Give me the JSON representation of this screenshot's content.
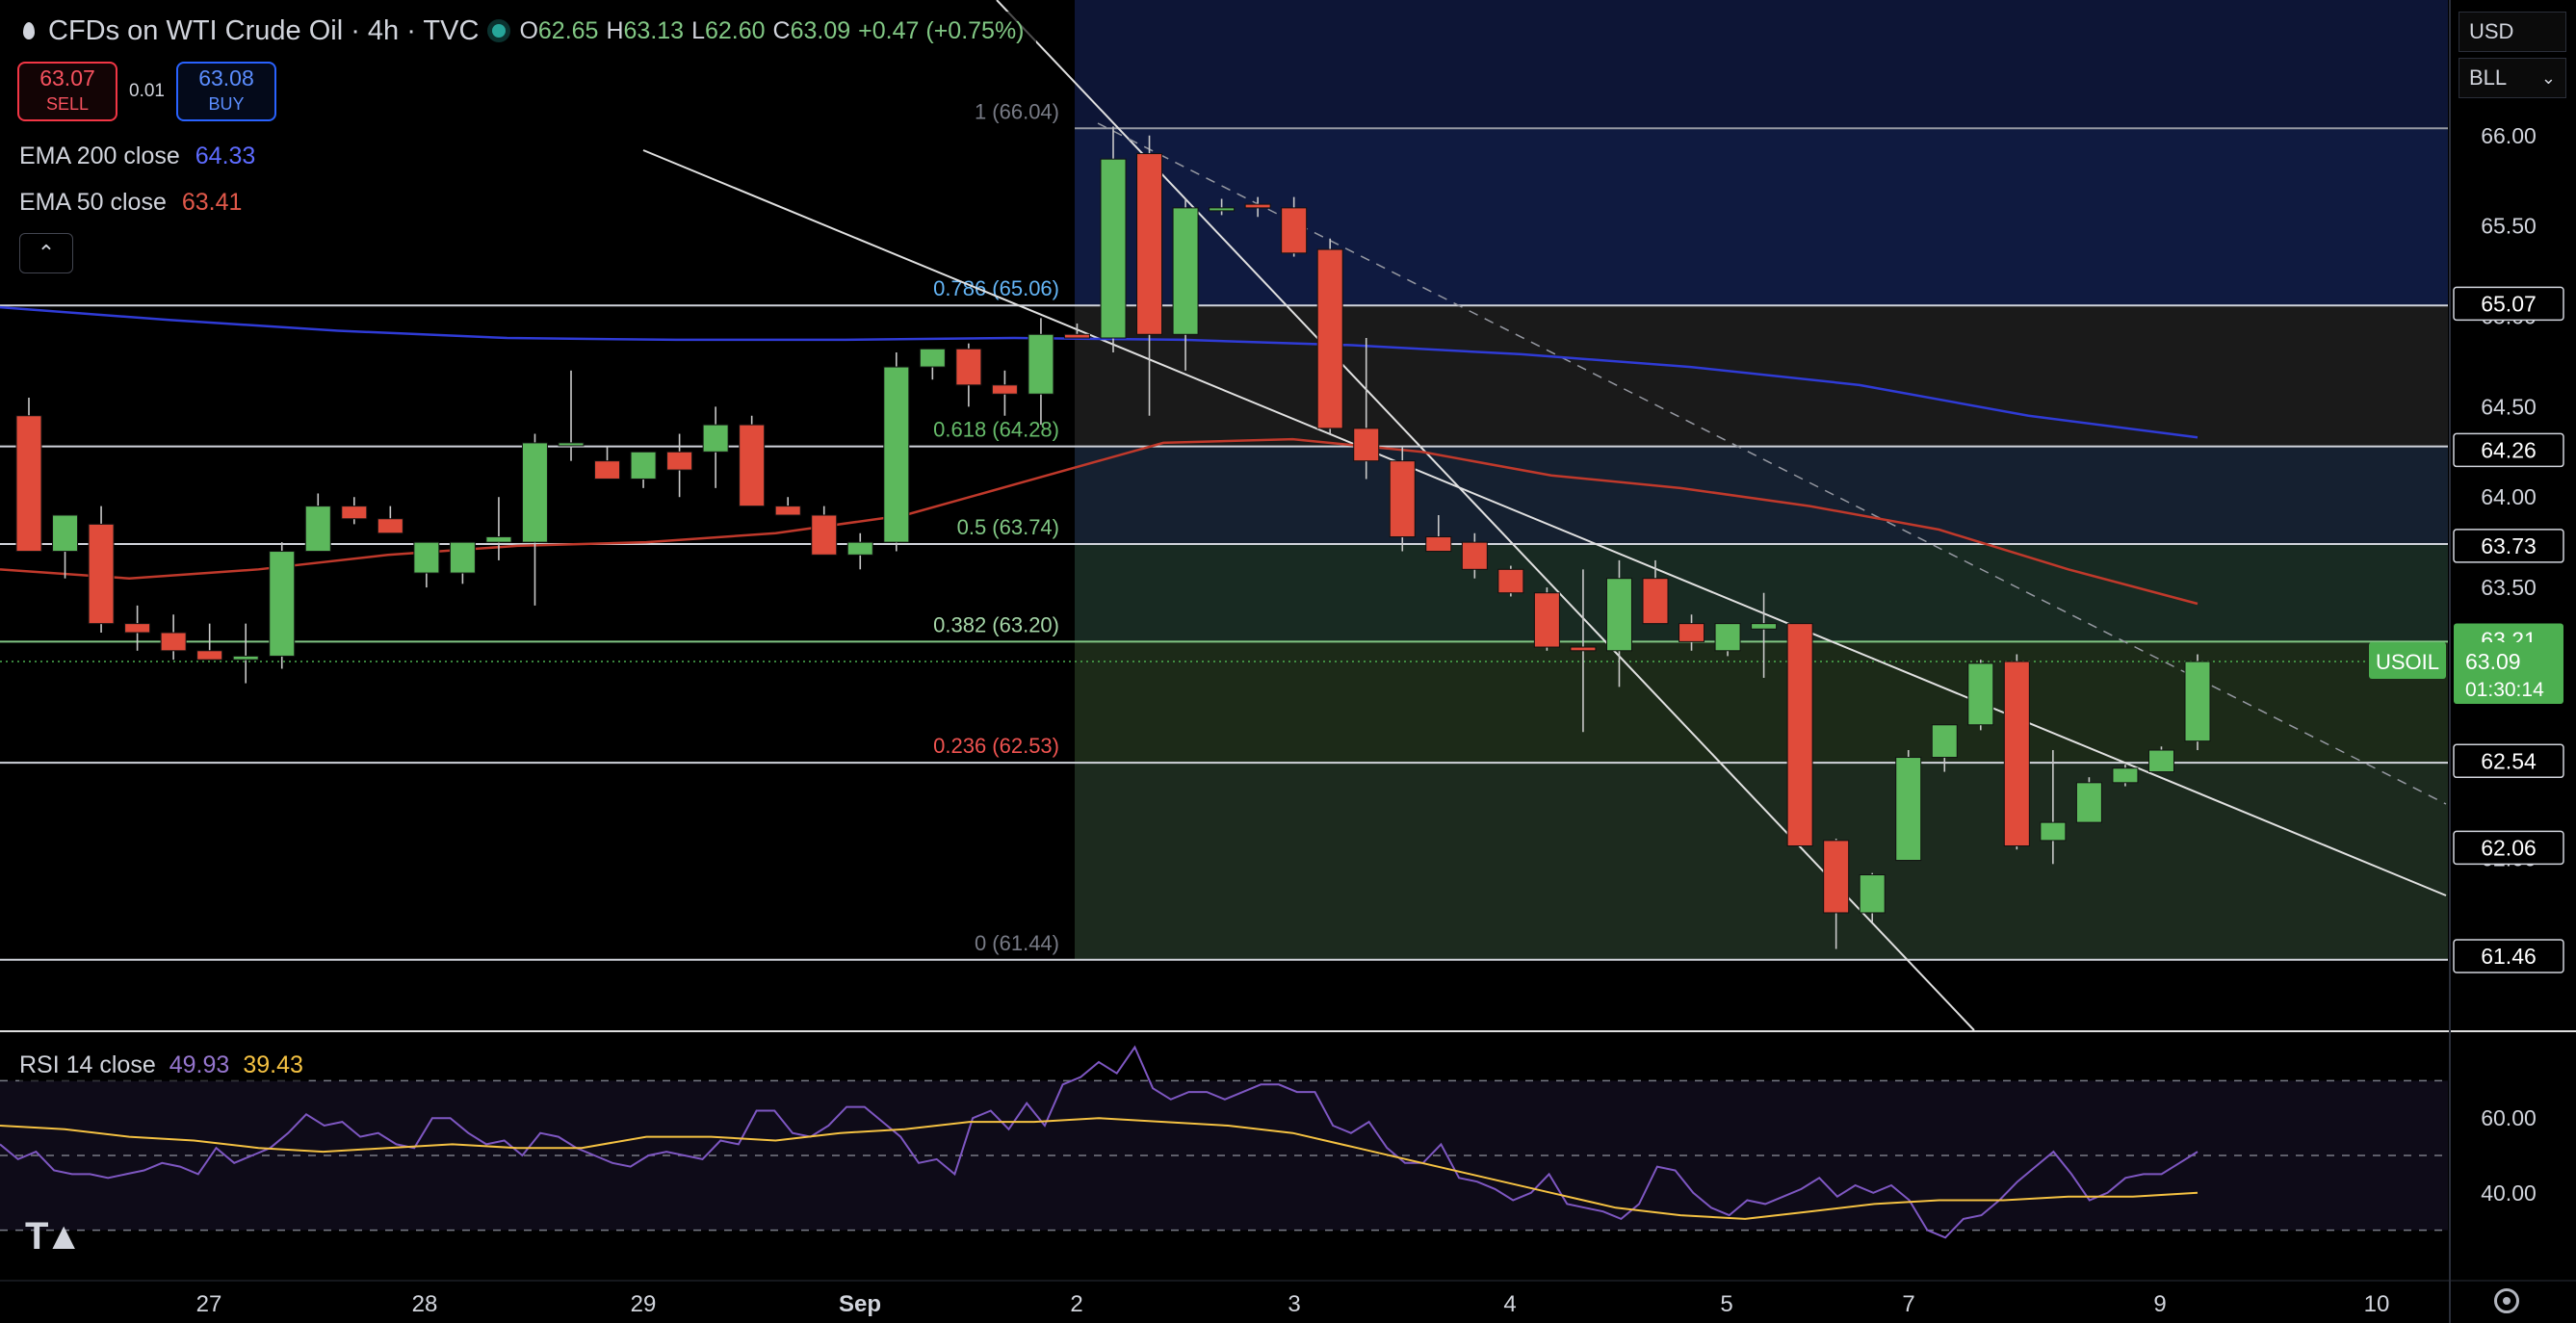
{
  "header": {
    "title": "CFDs on WTI Crude Oil · 4h · TVC",
    "open_label": "O",
    "open": "62.65",
    "high_label": "H",
    "high": "63.13",
    "low_label": "L",
    "low": "62.60",
    "close_label": "C",
    "close": "63.09",
    "change": "+0.47 (+0.75%)"
  },
  "trade": {
    "sell_price": "63.07",
    "sell_label": "SELL",
    "spread": "0.01",
    "buy_price": "63.08",
    "buy_label": "BUY"
  },
  "indicators": {
    "ema200_label": "EMA 200 close",
    "ema200_value": "64.33",
    "ema50_label": "EMA 50 close",
    "ema50_value": "63.41",
    "rsi_label": "RSI 14 close",
    "rsi_value": "49.93",
    "rsi_ma_value": "39.43"
  },
  "selectors": {
    "currency": "USD",
    "unit": "BLL"
  },
  "colors": {
    "up": "#5cb85c",
    "down": "#e04b3a",
    "ema200": "#2f3bd6",
    "ema50": "#c0392b",
    "rsi": "#7e57c2",
    "rsi_ma": "#f5c242"
  },
  "chart_data": {
    "type": "candlestick",
    "symbol": "USOIL",
    "timeframe": "4h",
    "x_ticks": [
      "27",
      "28",
      "29",
      "Sep",
      "2",
      "3",
      "4",
      "5",
      "7",
      "9",
      "10"
    ],
    "y_ticks": [
      "66.00",
      "65.50",
      "65.00",
      "64.50",
      "64.00",
      "63.50",
      "63.00",
      "62.50",
      "62.00",
      "61.50"
    ],
    "ylim": [
      61.05,
      66.75
    ],
    "candles": [
      [
        64.45,
        64.55,
        63.7,
        63.7
      ],
      [
        63.7,
        63.9,
        63.55,
        63.9
      ],
      [
        63.85,
        63.95,
        63.25,
        63.3
      ],
      [
        63.3,
        63.4,
        63.15,
        63.25
      ],
      [
        63.25,
        63.35,
        63.1,
        63.15
      ],
      [
        63.15,
        63.3,
        63.1,
        63.1
      ],
      [
        63.1,
        63.3,
        62.97,
        63.12
      ],
      [
        63.12,
        63.75,
        63.05,
        63.7
      ],
      [
        63.7,
        64.02,
        63.7,
        63.95
      ],
      [
        63.95,
        64.0,
        63.85,
        63.88
      ],
      [
        63.88,
        63.95,
        63.8,
        63.8
      ],
      [
        63.58,
        63.75,
        63.5,
        63.75
      ],
      [
        63.58,
        63.75,
        63.52,
        63.75
      ],
      [
        63.75,
        64.0,
        63.65,
        63.78
      ],
      [
        63.75,
        64.35,
        63.4,
        64.3
      ],
      [
        64.3,
        64.7,
        64.2,
        64.3
      ],
      [
        64.2,
        64.28,
        64.1,
        64.1
      ],
      [
        64.1,
        64.25,
        64.05,
        64.25
      ],
      [
        64.25,
        64.35,
        64.0,
        64.15
      ],
      [
        64.25,
        64.5,
        64.05,
        64.4
      ],
      [
        64.4,
        64.45,
        63.95,
        63.95
      ],
      [
        63.95,
        64.0,
        63.9,
        63.9
      ],
      [
        63.9,
        63.95,
        63.68,
        63.68
      ],
      [
        63.68,
        63.8,
        63.6,
        63.75
      ],
      [
        63.75,
        64.8,
        63.7,
        64.72
      ],
      [
        64.72,
        64.82,
        64.65,
        64.82
      ],
      [
        64.82,
        64.85,
        64.5,
        64.62
      ],
      [
        64.62,
        64.7,
        64.45,
        64.57
      ],
      [
        64.57,
        64.99,
        64.4,
        64.9
      ],
      [
        64.9,
        64.96,
        64.88,
        64.88
      ],
      [
        64.88,
        66.05,
        64.8,
        65.87
      ],
      [
        65.9,
        66.0,
        64.45,
        64.9
      ],
      [
        64.9,
        65.65,
        64.7,
        65.6
      ],
      [
        65.6,
        65.65,
        65.56,
        65.6
      ],
      [
        65.62,
        65.66,
        65.55,
        65.6
      ],
      [
        65.6,
        65.66,
        65.33,
        65.35
      ],
      [
        65.37,
        65.43,
        64.35,
        64.38
      ],
      [
        64.38,
        64.88,
        64.1,
        64.2
      ],
      [
        64.2,
        64.28,
        63.7,
        63.78
      ],
      [
        63.78,
        63.9,
        63.7,
        63.7
      ],
      [
        63.75,
        63.8,
        63.55,
        63.6
      ],
      [
        63.6,
        63.62,
        63.45,
        63.47
      ],
      [
        63.47,
        63.5,
        63.15,
        63.17
      ],
      [
        63.17,
        63.6,
        62.7,
        63.15
      ],
      [
        63.15,
        63.65,
        62.95,
        63.55
      ],
      [
        63.55,
        63.65,
        63.3,
        63.3
      ],
      [
        63.3,
        63.35,
        63.15,
        63.2
      ],
      [
        63.15,
        63.3,
        63.12,
        63.3
      ],
      [
        63.27,
        63.47,
        63.0,
        63.3
      ],
      [
        63.3,
        63.3,
        62.07,
        62.07
      ],
      [
        62.1,
        62.11,
        61.5,
        61.7
      ],
      [
        61.7,
        61.92,
        61.65,
        61.91
      ],
      [
        61.99,
        62.6,
        61.99,
        62.56
      ],
      [
        62.56,
        62.72,
        62.48,
        62.74
      ],
      [
        62.74,
        63.1,
        62.71,
        63.08
      ],
      [
        63.09,
        63.13,
        62.05,
        62.07
      ],
      [
        62.1,
        62.6,
        61.97,
        62.2
      ],
      [
        62.2,
        62.45,
        62.2,
        62.42
      ],
      [
        62.42,
        62.52,
        62.4,
        62.5
      ],
      [
        62.48,
        62.62,
        62.48,
        62.6
      ],
      [
        62.65,
        63.13,
        62.6,
        63.09
      ]
    ],
    "ema200": [
      65.05,
      64.98,
      64.92,
      64.88,
      64.87,
      64.87,
      64.88,
      64.87,
      64.84,
      64.79,
      64.72,
      64.62,
      64.45,
      64.33
    ],
    "ema50": [
      63.6,
      63.55,
      63.6,
      63.68,
      63.73,
      63.75,
      63.8,
      63.9,
      64.1,
      64.3,
      64.32,
      64.25,
      64.12,
      64.05,
      63.95,
      63.82,
      63.6,
      63.41
    ],
    "fibonacci": [
      {
        "level": "1",
        "price": "66.04"
      },
      {
        "level": "0.786",
        "price": "65.06"
      },
      {
        "level": "0.618",
        "price": "64.28"
      },
      {
        "level": "0.5",
        "price": "63.74"
      },
      {
        "level": "0.382",
        "price": "63.20"
      },
      {
        "level": "0.236",
        "price": "62.53"
      },
      {
        "level": "0",
        "price": "61.44"
      }
    ],
    "price_labels": [
      "66.00",
      "65.07",
      "64.26",
      "63.73",
      "63.21",
      "62.54",
      "62.06",
      "61.46"
    ],
    "current": {
      "symbol": "USOIL",
      "price": "63.09",
      "countdown": "01:30:14"
    },
    "rsi": {
      "ylim": [
        17,
        83
      ],
      "ticks": [
        "60.00",
        "40.00"
      ],
      "levels": [
        70,
        50,
        30
      ],
      "values": [
        53,
        49,
        51,
        46,
        45,
        45,
        44,
        45,
        46,
        48,
        47,
        45,
        52,
        48,
        50,
        52,
        56,
        61,
        58,
        59,
        55,
        56,
        53,
        52,
        60,
        60,
        56,
        53,
        54,
        50,
        56,
        55,
        52,
        50,
        48,
        47,
        50,
        51,
        50,
        49,
        54,
        53,
        62,
        62,
        56,
        55,
        58,
        63,
        63,
        59,
        55,
        48,
        49,
        45,
        60,
        62,
        57,
        64,
        58,
        69,
        71,
        75,
        72,
        79,
        68,
        65,
        67,
        67,
        65,
        67,
        69,
        69,
        67,
        67,
        58,
        56,
        59,
        52,
        48,
        48,
        53,
        44,
        43,
        41,
        38,
        40,
        45,
        37,
        36,
        35,
        33,
        37,
        47,
        46,
        40,
        36,
        34,
        38,
        37,
        39,
        41,
        44,
        39,
        42,
        40,
        42,
        38,
        30,
        28,
        33,
        34,
        38,
        43,
        47,
        51,
        45,
        38,
        40,
        44,
        45,
        45,
        48,
        51
      ],
      "ma": [
        58,
        57,
        55,
        54,
        52,
        51,
        52,
        53,
        52,
        52,
        55,
        55,
        54,
        56,
        57,
        59,
        59,
        60,
        59,
        58,
        56,
        52,
        48,
        44,
        40,
        36,
        34,
        33,
        35,
        37,
        38,
        38,
        39,
        39,
        40
      ]
    }
  }
}
